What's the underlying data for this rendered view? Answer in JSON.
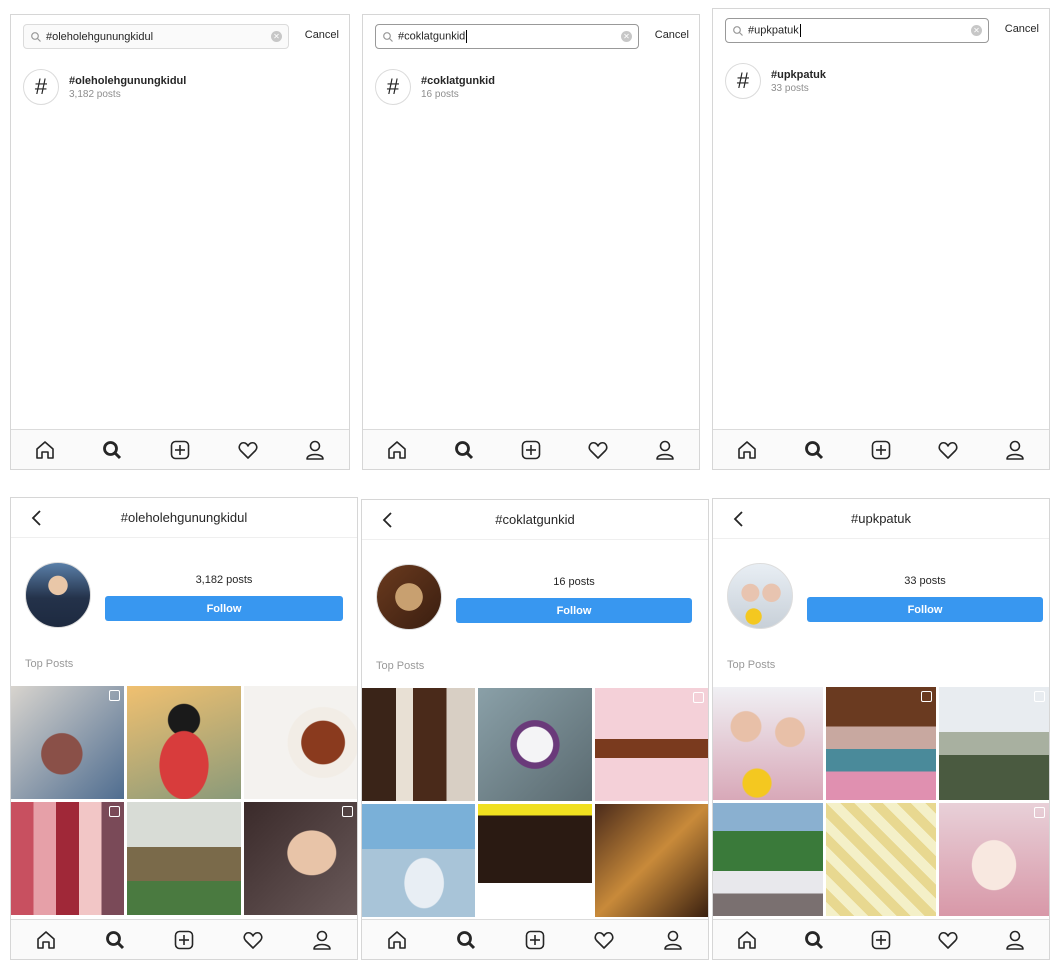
{
  "search_screens": [
    {
      "query": "#oleholehgunungkidul",
      "cancel_label": "Cancel",
      "result": {
        "hash_glyph": "#",
        "tag": "#oleholehgunungkidul",
        "count": "3,182 posts"
      }
    },
    {
      "query": "#coklatgunkid",
      "cancel_label": "Cancel",
      "result": {
        "hash_glyph": "#",
        "tag": "#coklatgunkid",
        "count": "16 posts"
      }
    },
    {
      "query": "#upkpatuk",
      "cancel_label": "Cancel",
      "result": {
        "hash_glyph": "#",
        "tag": "#upkpatuk",
        "count": "33 posts"
      }
    }
  ],
  "tag_screens": [
    {
      "title": "#oleholehgunungkidul",
      "posts": "3,182 posts",
      "follow_label": "Follow",
      "section": "Top Posts"
    },
    {
      "title": "#coklatgunkid",
      "posts": "16 posts",
      "follow_label": "Follow",
      "section": "Top Posts"
    },
    {
      "title": "#upkpatuk",
      "posts": "33 posts",
      "follow_label": "Follow",
      "section": "Top Posts"
    }
  ],
  "nav_icons": [
    "home-icon",
    "search-icon",
    "add-icon",
    "heart-icon",
    "profile-icon"
  ],
  "colors": {
    "follow": "#3897f0",
    "border": "#dbdbdb",
    "muted": "#8e8e8e"
  }
}
